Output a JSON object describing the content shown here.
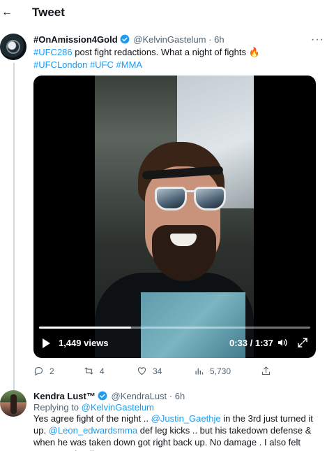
{
  "header": {
    "back_icon": "arrow-left-icon",
    "title": "Tweet"
  },
  "tweet": {
    "display_name": "#OnAmission4Gold",
    "handle": "@KelvinGastelum",
    "separator": "·",
    "time": "6h",
    "more_icon": "more-horizontal-icon",
    "text_lead": "#UFC286",
    "text_main": " post fight redactions. What a night of fights ",
    "text_emoji": "🔥",
    "hashtags": [
      "#UFCLondon",
      "#UFC",
      "#MMA"
    ],
    "video": {
      "views": "1,449 views",
      "current_time": "0:33",
      "time_separator": " / ",
      "duration": "1:37",
      "progress_fraction": 0.34
    },
    "actions": {
      "replies": "2",
      "retweets": "4",
      "likes": "34",
      "views": "5,730"
    }
  },
  "reply": {
    "display_name": "Kendra Lust™",
    "handle": "@KendraLust",
    "separator": "·",
    "time": "6h",
    "replying_prefix": "Replying to ",
    "replying_to": "@KelvinGastelum",
    "line1_a": "Yes agree fight of the night ..  ",
    "mention1": "@Justin_Gaethje",
    "line1_b": " in the 3rd just turned it up.",
    "mention2": "@Leon_edwardsmma",
    "line2": " def leg kicks .. but his takedown defense & when he was taken down got right back up. No damage . I also felt Leon was leading ....."
  },
  "colors": {
    "accent": "#1d9bf0",
    "text_primary": "#0f1419",
    "text_secondary": "#536471"
  }
}
